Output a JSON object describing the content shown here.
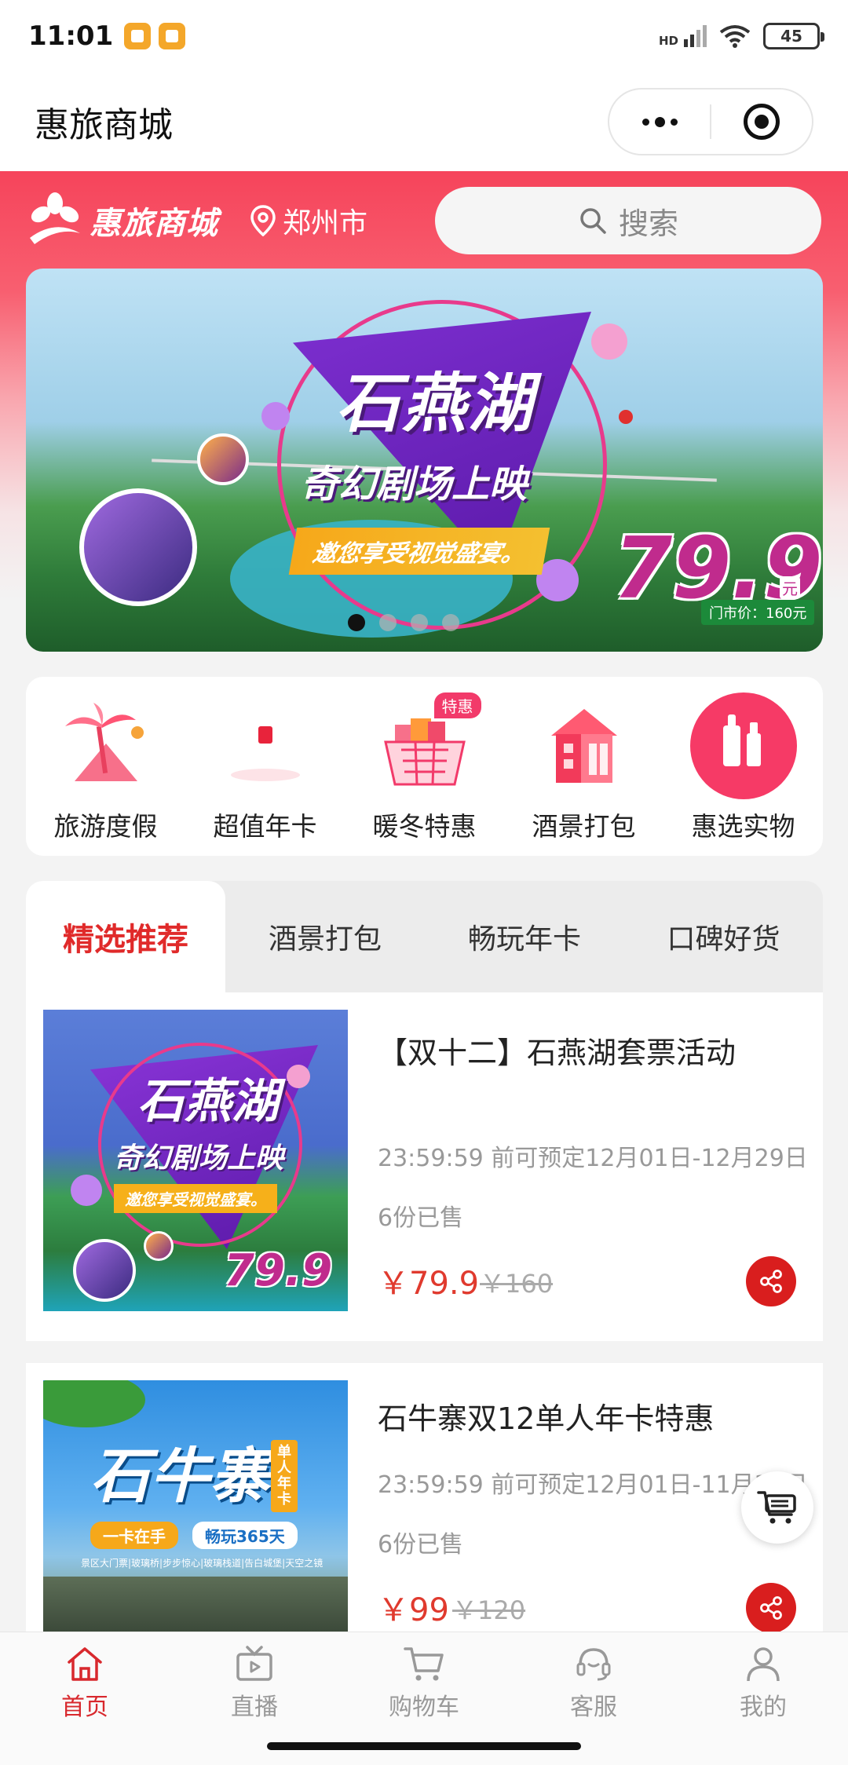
{
  "status_bar": {
    "time": "11:01",
    "network": "HD",
    "battery": "45"
  },
  "title_bar": {
    "title": "惠旅商城"
  },
  "header": {
    "brand": "惠旅商城",
    "city": "郑州市",
    "search_placeholder": "搜索"
  },
  "banner": {
    "headline": "石燕湖",
    "subline": "奇幻剧场上映",
    "tagline": "邀您享受视觉盛宴。",
    "price": "79.9",
    "price_unit": "元",
    "market_price": "门市价：160元",
    "slide_count": 4,
    "active_slide": 1
  },
  "categories": [
    {
      "label": "旅游度假",
      "icon": "palm-tree-icon"
    },
    {
      "label": "超值年卡",
      "icon": "annual-card-icon"
    },
    {
      "label": "暖冬特惠",
      "icon": "shopping-basket-icon",
      "badge": "特惠"
    },
    {
      "label": "酒景打包",
      "icon": "hotel-building-icon"
    },
    {
      "label": "惠选实物",
      "icon": "cosmetics-icon"
    }
  ],
  "tabs": [
    {
      "label": "精选推荐",
      "active": true
    },
    {
      "label": "酒景打包",
      "active": false
    },
    {
      "label": "畅玩年卡",
      "active": false
    },
    {
      "label": "口碑好货",
      "active": false
    }
  ],
  "products": [
    {
      "title": "【双十二】石燕湖套票活动",
      "time": "23:59:59 前可预定12月01日-12月29日",
      "sold": "6份已售",
      "price": "￥79.9",
      "old_price": "￥160",
      "image_headline": "石燕湖",
      "image_subline": "奇幻剧场上映",
      "image_tag": "邀您享受视觉盛宴。",
      "image_price": "79.9"
    },
    {
      "title": "石牛寨双12单人年卡特惠",
      "time": "23:59:59 前可预定12月01日-11月30日",
      "sold": "6份已售",
      "price": "￥99",
      "old_price": "￥120",
      "image_headline": "石牛寨",
      "image_side": "单人年卡",
      "image_tag1": "一卡在手",
      "image_tag2": "畅玩365天",
      "image_desc": "景区大门票|玻璃桥|步步惊心|玻璃栈道|告白城堡|天空之镜"
    }
  ],
  "nav": [
    {
      "label": "首页",
      "icon": "home-icon",
      "active": true
    },
    {
      "label": "直播",
      "icon": "tv-live-icon",
      "active": false
    },
    {
      "label": "购物车",
      "icon": "cart-icon",
      "active": false
    },
    {
      "label": "客服",
      "icon": "headset-icon",
      "active": false
    },
    {
      "label": "我的",
      "icon": "user-icon",
      "active": false
    }
  ],
  "colors": {
    "brand": "#f6445b",
    "active_tab": "#e02a2a",
    "price": "#e03a2e",
    "share": "#d91e1e"
  }
}
